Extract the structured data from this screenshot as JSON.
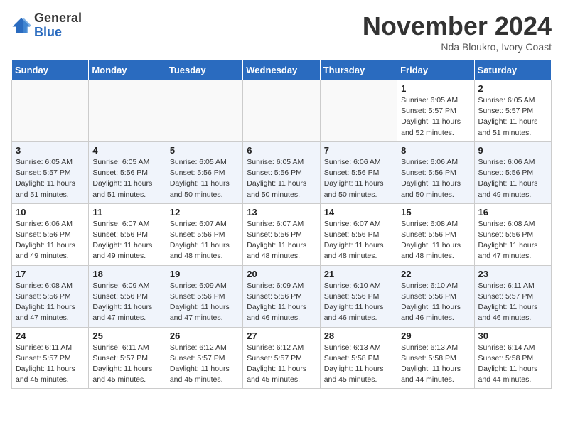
{
  "logo": {
    "general": "General",
    "blue": "Blue"
  },
  "title": "November 2024",
  "location": "Nda Bloukro, Ivory Coast",
  "days_of_week": [
    "Sunday",
    "Monday",
    "Tuesday",
    "Wednesday",
    "Thursday",
    "Friday",
    "Saturday"
  ],
  "weeks": [
    [
      {
        "day": "",
        "info": ""
      },
      {
        "day": "",
        "info": ""
      },
      {
        "day": "",
        "info": ""
      },
      {
        "day": "",
        "info": ""
      },
      {
        "day": "",
        "info": ""
      },
      {
        "day": "1",
        "info": "Sunrise: 6:05 AM\nSunset: 5:57 PM\nDaylight: 11 hours\nand 52 minutes."
      },
      {
        "day": "2",
        "info": "Sunrise: 6:05 AM\nSunset: 5:57 PM\nDaylight: 11 hours\nand 51 minutes."
      }
    ],
    [
      {
        "day": "3",
        "info": "Sunrise: 6:05 AM\nSunset: 5:57 PM\nDaylight: 11 hours\nand 51 minutes."
      },
      {
        "day": "4",
        "info": "Sunrise: 6:05 AM\nSunset: 5:56 PM\nDaylight: 11 hours\nand 51 minutes."
      },
      {
        "day": "5",
        "info": "Sunrise: 6:05 AM\nSunset: 5:56 PM\nDaylight: 11 hours\nand 50 minutes."
      },
      {
        "day": "6",
        "info": "Sunrise: 6:05 AM\nSunset: 5:56 PM\nDaylight: 11 hours\nand 50 minutes."
      },
      {
        "day": "7",
        "info": "Sunrise: 6:06 AM\nSunset: 5:56 PM\nDaylight: 11 hours\nand 50 minutes."
      },
      {
        "day": "8",
        "info": "Sunrise: 6:06 AM\nSunset: 5:56 PM\nDaylight: 11 hours\nand 50 minutes."
      },
      {
        "day": "9",
        "info": "Sunrise: 6:06 AM\nSunset: 5:56 PM\nDaylight: 11 hours\nand 49 minutes."
      }
    ],
    [
      {
        "day": "10",
        "info": "Sunrise: 6:06 AM\nSunset: 5:56 PM\nDaylight: 11 hours\nand 49 minutes."
      },
      {
        "day": "11",
        "info": "Sunrise: 6:07 AM\nSunset: 5:56 PM\nDaylight: 11 hours\nand 49 minutes."
      },
      {
        "day": "12",
        "info": "Sunrise: 6:07 AM\nSunset: 5:56 PM\nDaylight: 11 hours\nand 48 minutes."
      },
      {
        "day": "13",
        "info": "Sunrise: 6:07 AM\nSunset: 5:56 PM\nDaylight: 11 hours\nand 48 minutes."
      },
      {
        "day": "14",
        "info": "Sunrise: 6:07 AM\nSunset: 5:56 PM\nDaylight: 11 hours\nand 48 minutes."
      },
      {
        "day": "15",
        "info": "Sunrise: 6:08 AM\nSunset: 5:56 PM\nDaylight: 11 hours\nand 48 minutes."
      },
      {
        "day": "16",
        "info": "Sunrise: 6:08 AM\nSunset: 5:56 PM\nDaylight: 11 hours\nand 47 minutes."
      }
    ],
    [
      {
        "day": "17",
        "info": "Sunrise: 6:08 AM\nSunset: 5:56 PM\nDaylight: 11 hours\nand 47 minutes."
      },
      {
        "day": "18",
        "info": "Sunrise: 6:09 AM\nSunset: 5:56 PM\nDaylight: 11 hours\nand 47 minutes."
      },
      {
        "day": "19",
        "info": "Sunrise: 6:09 AM\nSunset: 5:56 PM\nDaylight: 11 hours\nand 47 minutes."
      },
      {
        "day": "20",
        "info": "Sunrise: 6:09 AM\nSunset: 5:56 PM\nDaylight: 11 hours\nand 46 minutes."
      },
      {
        "day": "21",
        "info": "Sunrise: 6:10 AM\nSunset: 5:56 PM\nDaylight: 11 hours\nand 46 minutes."
      },
      {
        "day": "22",
        "info": "Sunrise: 6:10 AM\nSunset: 5:56 PM\nDaylight: 11 hours\nand 46 minutes."
      },
      {
        "day": "23",
        "info": "Sunrise: 6:11 AM\nSunset: 5:57 PM\nDaylight: 11 hours\nand 46 minutes."
      }
    ],
    [
      {
        "day": "24",
        "info": "Sunrise: 6:11 AM\nSunset: 5:57 PM\nDaylight: 11 hours\nand 45 minutes."
      },
      {
        "day": "25",
        "info": "Sunrise: 6:11 AM\nSunset: 5:57 PM\nDaylight: 11 hours\nand 45 minutes."
      },
      {
        "day": "26",
        "info": "Sunrise: 6:12 AM\nSunset: 5:57 PM\nDaylight: 11 hours\nand 45 minutes."
      },
      {
        "day": "27",
        "info": "Sunrise: 6:12 AM\nSunset: 5:57 PM\nDaylight: 11 hours\nand 45 minutes."
      },
      {
        "day": "28",
        "info": "Sunrise: 6:13 AM\nSunset: 5:58 PM\nDaylight: 11 hours\nand 45 minutes."
      },
      {
        "day": "29",
        "info": "Sunrise: 6:13 AM\nSunset: 5:58 PM\nDaylight: 11 hours\nand 44 minutes."
      },
      {
        "day": "30",
        "info": "Sunrise: 6:14 AM\nSunset: 5:58 PM\nDaylight: 11 hours\nand 44 minutes."
      }
    ]
  ]
}
